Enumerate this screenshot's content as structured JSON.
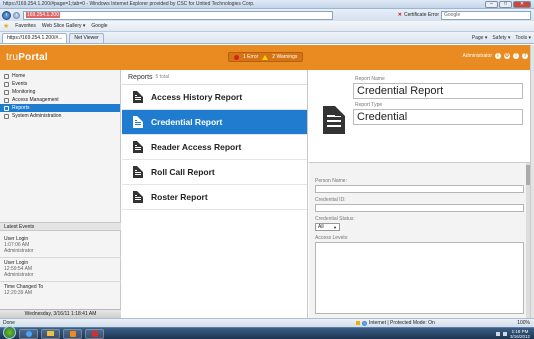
{
  "browser": {
    "title": "https://169.254.1.200/#page=1;tab=0 - Windows Internet Explorer provided by CSC for United Technologies Corp.",
    "address": "https://169.254.1.200/#page=1;tab=0",
    "address_highlight": "169.254.1.200",
    "cert_error": "Certificate Error",
    "search_placeholder": "Google",
    "favorites_label": "Favorites",
    "fav_items": [
      "Web Slice Gallery ▾",
      "Google"
    ],
    "tabs": [
      {
        "label": "https://169.254.1.200/#..."
      },
      {
        "label": "Net Viewer"
      }
    ],
    "toolbar": [
      "Page ▾",
      "Safety ▾",
      "Tools ▾"
    ],
    "status_left": "Done",
    "status_mid": "Internet | Protected Mode: On",
    "zoom": "100%"
  },
  "app": {
    "logo_light": "tru",
    "logo_bold": "Portal",
    "errors": "1 Error",
    "warnings": "2 Warnings",
    "username": "Administrator"
  },
  "sidebar": {
    "nav": [
      {
        "label": "Home"
      },
      {
        "label": "Events"
      },
      {
        "label": "Monitoring"
      },
      {
        "label": "Access Management"
      },
      {
        "label": "Reports"
      },
      {
        "label": "System Administration"
      }
    ],
    "latest_events_title": "Latest Events",
    "events": [
      {
        "title": "User Login",
        "time": "1:07:06 AM",
        "user": "Administrator"
      },
      {
        "title": "User Login",
        "time": "12:59:54 AM",
        "user": "Administrator"
      },
      {
        "title": "Time Changed To",
        "time": "12:20:39 AM",
        "user": ""
      }
    ],
    "datetime": "Wednesday, 3/16/11 1:18:41 AM"
  },
  "reports": {
    "title": "Reports",
    "count": "5 total",
    "items": [
      {
        "label": "Access History Report"
      },
      {
        "label": "Credential Report"
      },
      {
        "label": "Reader Access Report"
      },
      {
        "label": "Roll Call Report"
      },
      {
        "label": "Roster Report"
      }
    ]
  },
  "details": {
    "report_name_label": "Report Name",
    "report_name": "Credential Report",
    "report_type_label": "Report Type",
    "report_type": "Credential",
    "person_name_label": "Person Name:",
    "credential_id_label": "Credential ID:",
    "credential_status_label": "Credential Status:",
    "credential_status_value": "All",
    "access_levels_label": "Access Levels:"
  },
  "taskbar": {
    "time": "1:18 PM",
    "date": "3/16/2012"
  }
}
